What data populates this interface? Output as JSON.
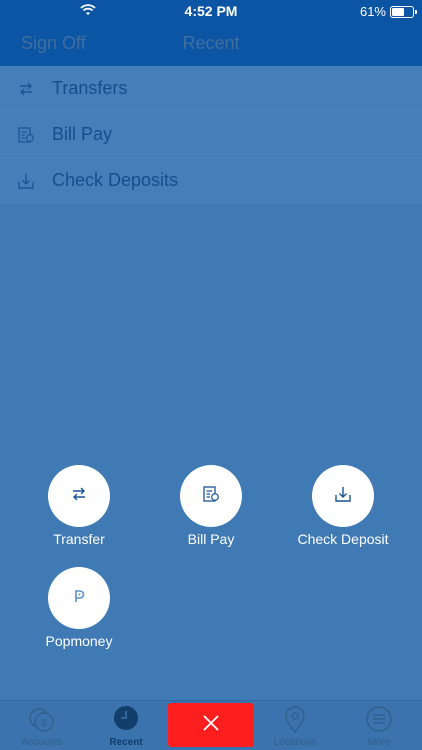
{
  "status_bar": {
    "time": "4:52 PM",
    "battery": "61%"
  },
  "nav": {
    "left_button": "Sign Off",
    "title": "Recent"
  },
  "recent": [
    {
      "label": "Transfers",
      "icon": "transfer-icon"
    },
    {
      "label": "Bill Pay",
      "icon": "bill-pay-icon"
    },
    {
      "label": "Check Deposits",
      "icon": "check-deposit-icon"
    }
  ],
  "actions": [
    {
      "label": "Transfer",
      "icon": "transfer-icon"
    },
    {
      "label": "Bill Pay",
      "icon": "bill-pay-icon"
    },
    {
      "label": "Check Deposit",
      "icon": "check-deposit-icon"
    },
    {
      "label": "Popmoney",
      "icon": "popmoney-icon"
    }
  ],
  "tabs": [
    {
      "label": "Accounts",
      "icon": "accounts-icon"
    },
    {
      "label": "Recent",
      "icon": "clock-icon",
      "active": true
    },
    {
      "label": "",
      "icon": "close-icon"
    },
    {
      "label": "Locations",
      "icon": "location-pin-icon"
    },
    {
      "label": "More",
      "icon": "menu-icon"
    }
  ],
  "colors": {
    "nav": "#0c55a4",
    "background": "#3f7ab5",
    "close": "#ff1e1e"
  }
}
